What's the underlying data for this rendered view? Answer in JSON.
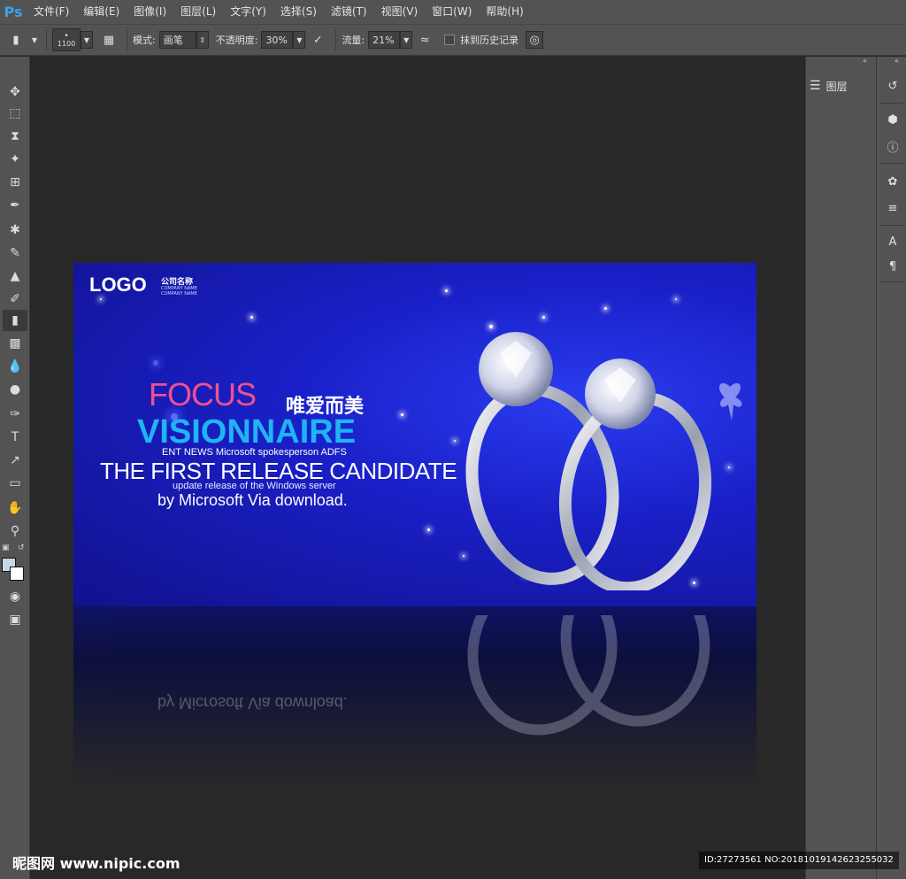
{
  "app": {
    "logo": "Ps"
  },
  "menu": [
    "文件(F)",
    "编辑(E)",
    "图像(I)",
    "图层(L)",
    "文字(Y)",
    "选择(S)",
    "滤镜(T)",
    "视图(V)",
    "窗口(W)",
    "帮助(H)"
  ],
  "options": {
    "brush_size": "1100",
    "mode_label": "模式:",
    "mode_value": "画笔",
    "opacity_label": "不透明度:",
    "opacity_value": "30%",
    "flow_label": "流量:",
    "flow_value": "21%",
    "erase_history_label": "抹到历史记录"
  },
  "tools": [
    "move-tool",
    "marquee-tool",
    "lasso-tool",
    "magic-wand-tool",
    "crop-tool",
    "eyedropper-tool",
    "healing-tool",
    "brush-tool",
    "stamp-tool",
    "history-brush-tool",
    "eraser-tool",
    "gradient-tool",
    "blur-tool",
    "dodge-tool",
    "pen-tool",
    "type-tool",
    "path-select-tool",
    "shape-tool",
    "hand-tool",
    "zoom-tool"
  ],
  "panels": {
    "layers_label": "图层"
  },
  "colors": {
    "foreground": "#c8d8e8",
    "background": "#ffffff",
    "banner_blue": "#1a20c8",
    "focus_pink": "#f0508e",
    "visionnaire_cyan": "#1fb4f4"
  },
  "banner": {
    "logo": "LOGO",
    "company_cn": "公司名称",
    "company_en_1": "COMPANY NAME",
    "company_en_2": "COMPANY NAME",
    "focus": "FOCUS",
    "focus_cn": "唯爱而美",
    "visionnaire": "VISIONNAIRE",
    "ent_news": "ENT NEWS Microsoft spokesperson ADFS",
    "first_release": "THE FIRST RELEASE CANDIDATE",
    "update_release": "update release of the Windows server",
    "by_microsoft": "by Microsoft Via download."
  },
  "watermark": {
    "site": "昵图网 www.nipic.com",
    "id": "ID:27273561 NO:20181019142623255032"
  }
}
